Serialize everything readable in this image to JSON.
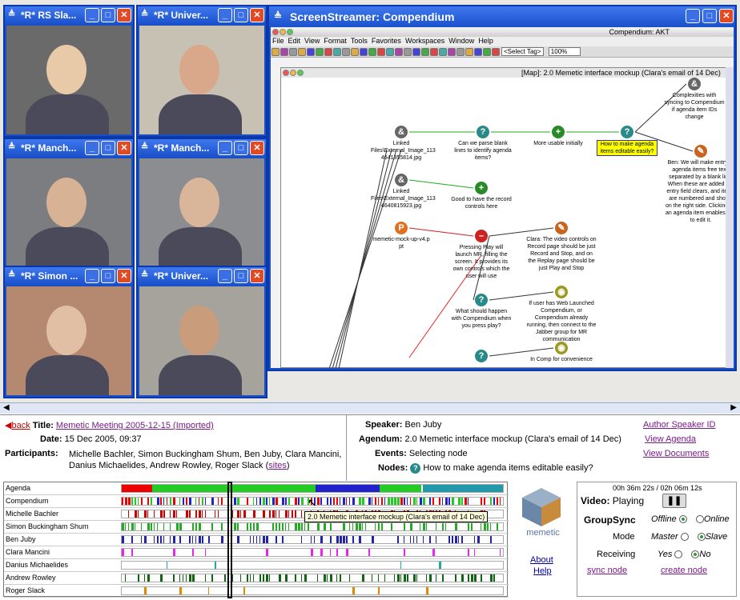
{
  "video_windows": [
    {
      "title": "*R* RS Sla...",
      "bg": "#6a6a6a",
      "person": "#e8c9a8"
    },
    {
      "title": "*R* Univer...",
      "bg": "#c7c1b4",
      "person": "#d9a88a"
    },
    {
      "title": "*R* Manch...",
      "bg": "#7b7d80",
      "person": "#d8b294"
    },
    {
      "title": "*R* Manch...",
      "bg": "#8c8d90",
      "person": "#d9b59a"
    },
    {
      "title": "*R* Simon ...",
      "bg": "#b58870",
      "person": "#e1bfa5"
    },
    {
      "title": "*R* Univer...",
      "bg": "#a6a39c",
      "person": "#c99c7c"
    }
  ],
  "screenstreamer": {
    "title": "ScreenStreamer: Compendium",
    "app_title": "Compendium: AKT",
    "menu": [
      "File",
      "Edit",
      "View",
      "Format",
      "Tools",
      "Favorites",
      "Workspaces",
      "Window",
      "Help"
    ],
    "select_tag": "<Select Tag>",
    "zoom": "100%",
    "map_title": "[Map]: 2.0 Memetic interface mockup (Clara's email of 14 Dec)"
  },
  "map_nodes": [
    {
      "icon": "link",
      "label": "Linked Files\\External_Image_113 4641355814.jpg"
    },
    {
      "icon": "question",
      "label": "Can we parse blank lines to identify agenda items?"
    },
    {
      "icon": "plus",
      "label": "More usable initially"
    },
    {
      "icon": "question",
      "label": "How to make agenda items editable easily?"
    },
    {
      "icon": "link",
      "label": "Complexities with syncing to Compendium if agenda item IDs change"
    },
    {
      "icon": "note",
      "label": "Ben: We will make entry of agenda items free text, separated by a blank line. When these are added the entry field clears, and items are numbered and shown on the right side. Clicking on an agenda item enables you to edit it."
    },
    {
      "icon": "link",
      "label": "Linked Files\\External_Image_113 4640815923.jpg"
    },
    {
      "icon": "plus",
      "label": "Good to have the record controls here"
    },
    {
      "icon": "ppt",
      "label": "memetic-mock-up-v4.p pt"
    },
    {
      "icon": "minus",
      "label": "Pressing Play will launch MR, filling the screen. It provides its own controls which the user will use"
    },
    {
      "icon": "note",
      "label": "Clara: The video controls on Record page should be just Record and Stop, and on the Replay page should be just Play and Stop"
    },
    {
      "icon": "question",
      "label": "What should happen with Compendium when you press play?"
    },
    {
      "icon": "bulb",
      "label": "If user has Web Launched Compendium, or Compendium already running, then connect to the Jabber group for MR communication"
    },
    {
      "icon": "question",
      "label": ""
    },
    {
      "icon": "bulb",
      "label": "In Comp for convenience"
    }
  ],
  "info": {
    "back": "back",
    "title_label": "Title:",
    "title_value": "Memetic Meeting 2005-12-15 (Imported)",
    "date_label": "Date:",
    "date_value": "15 Dec 2005, 09:37",
    "participants_label": "Participants:",
    "participants_value": "Michelle Bachler, Simon Buckingham Shum, Ben Juby, Clara Mancini, Danius Michaelides, Andrew Rowley, Roger Slack",
    "sites": "sites",
    "speaker_label": "Speaker:",
    "speaker_value": "Ben Juby",
    "agendum_label": "Agendum:",
    "agendum_value": "2.0 Memetic interface mockup (Clara's email of 14 Dec)",
    "events_label": "Events:",
    "events_value": "Selecting node",
    "nodes_label": "Nodes:",
    "nodes_value": "How to make agenda items editable easily?",
    "author_speaker_id": "Author Speaker ID",
    "view_agenda": "View Agenda",
    "view_documents": "View Documents"
  },
  "timeline_rows": [
    "Agenda",
    "Compendium",
    "Michelle Bachler",
    "Simon Buckingham Shum",
    "Ben Juby",
    "Clara Mancini",
    "Danius Michaelides",
    "Andrew Rowley",
    "Roger Slack"
  ],
  "tooltip": "2.0 Memetic interface mockup (Clara's email of 14 Dec)",
  "logo_text": "memetic",
  "about": "About",
  "help": "Help",
  "controls": {
    "time": "00h 36m 22s / 02h 06m 12s",
    "video_label": "Video:",
    "video_value": "Playing",
    "groupsync": "GroupSync",
    "offline": "Offline",
    "online": "Online",
    "mode": "Mode",
    "master": "Master",
    "slave": "Slave",
    "receiving": "Receiving",
    "yes": "Yes",
    "no": "No",
    "sync_node": "sync node",
    "create_node": "create node"
  }
}
